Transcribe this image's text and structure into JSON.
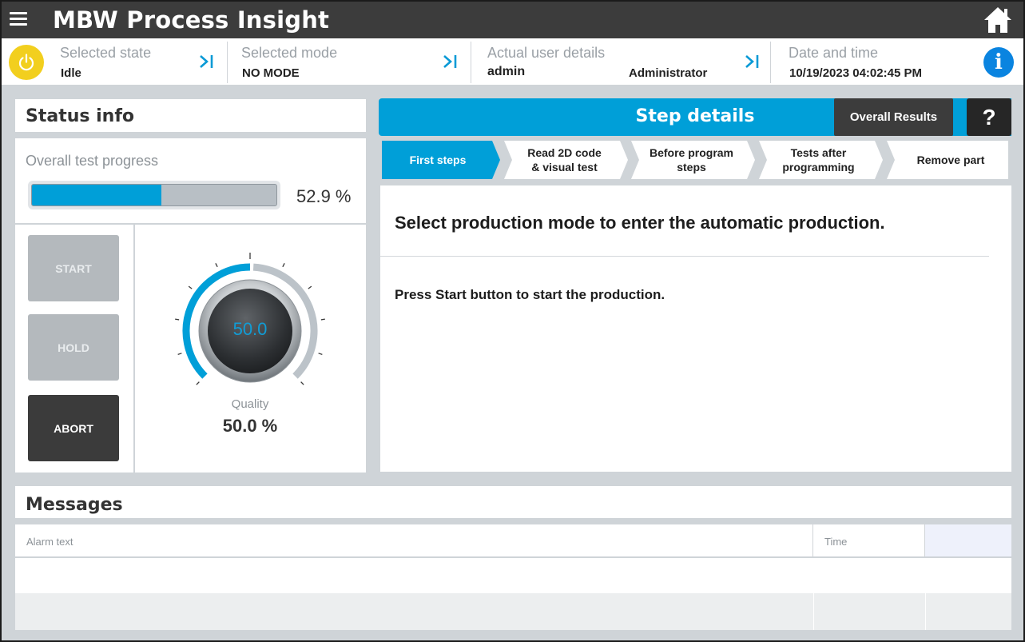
{
  "app": {
    "title": "MBW Process Insight"
  },
  "header": {
    "state_label": "Selected state",
    "state_value": "Idle",
    "mode_label": "Selected mode",
    "mode_value": "NO MODE",
    "user_label": "Actual user details",
    "user_value": "admin",
    "user_role": "Administrator",
    "datetime_label": "Date and time",
    "datetime_value": "10/19/2023 04:02:45 PM",
    "info_icon_text": "i"
  },
  "status": {
    "title": "Status info",
    "progress_label": "Overall test progress",
    "progress_fraction": 0.529,
    "progress_text": "52.9 %",
    "buttons": {
      "start": "START",
      "hold": "HOLD",
      "abort": "ABORT"
    },
    "gauge": {
      "value": 50.0,
      "value_text": "50.0",
      "min": 0,
      "max": 100,
      "label": "Quality",
      "percent_text": "50.0 %"
    }
  },
  "step_details": {
    "title": "Step details",
    "overall_button": "Overall Results",
    "help_button": "?",
    "tabs": [
      {
        "label": "First steps",
        "active": true
      },
      {
        "label": "Read 2D code\n& visual test",
        "active": false
      },
      {
        "label": "Before program\nsteps",
        "active": false
      },
      {
        "label": "Tests after\nprogramming",
        "active": false
      },
      {
        "label": "Remove part",
        "active": false
      }
    ],
    "main_text": "Select production mode to enter the automatic production.",
    "sub_text": "Press Start button to start the production."
  },
  "messages": {
    "title": "Messages",
    "columns": [
      "Alarm text",
      "Time",
      ""
    ],
    "rows": []
  },
  "colors": {
    "accent": "#009fd8",
    "topbar": "#3c3c3c",
    "power": "#f2cf1e",
    "info": "#0a84e0",
    "tab_inactive": "#ffffff",
    "background": "#cfd4d8"
  },
  "icons": {
    "menu": "menu-icon",
    "home": "home-icon",
    "power": "power-icon",
    "skip": "skip-forward-icon",
    "info": "info-icon"
  }
}
